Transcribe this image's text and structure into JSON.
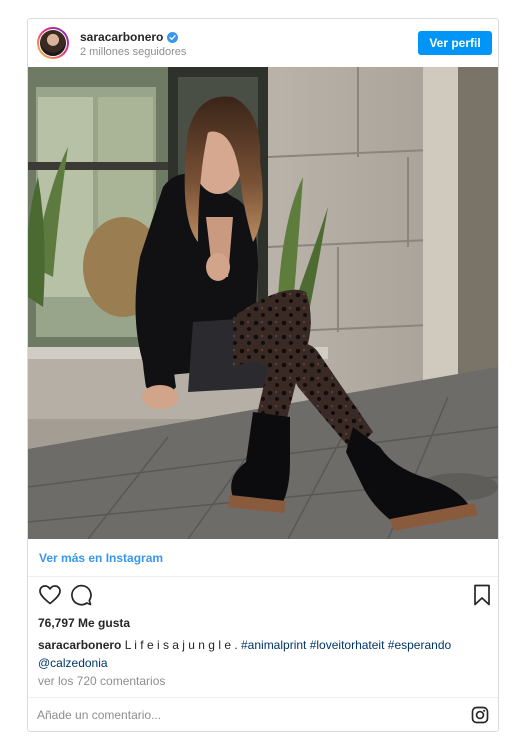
{
  "header": {
    "username": "saracarbonero",
    "verified": true,
    "followers": "2 millones seguidores",
    "profile_button": "Ver perfil",
    "accent": "#0095f6"
  },
  "photo": {
    "subject": "woman-sitting-on-step-leopard-tights-black-boots"
  },
  "see_more": "Ver más en Instagram",
  "actions": {
    "icons": [
      "heart-icon",
      "comment-icon",
      "bookmark-icon"
    ]
  },
  "likes": "76,797 Me gusta",
  "caption": {
    "username": "saracarbonero",
    "text": " L i f e i s a j u n g l e . ",
    "hashtags": [
      "#animalprint",
      "#loveitorhateit",
      "#esperando"
    ],
    "mention": "@calzedonia"
  },
  "comments_link": "ver los 720 comentarios",
  "comment_box": {
    "placeholder": "Añade un comentario...",
    "icon": "instagram-icon"
  }
}
